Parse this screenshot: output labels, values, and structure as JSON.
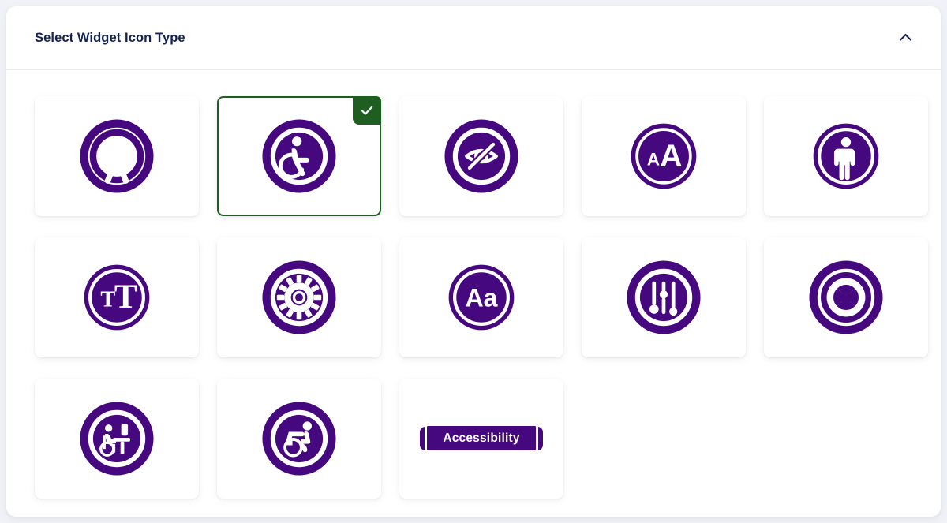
{
  "page": {
    "background_color": "#f1f2f7",
    "panel_background": "#ffffff"
  },
  "header": {
    "title": "Select Widget Icon Type",
    "title_color": "#152252",
    "collapse_icon": "chevron-up-icon",
    "collapsed": false
  },
  "theme": {
    "icon_color": "#46087f",
    "selected_border_color": "#1e5e20",
    "check_badge_color": "#1e5e20",
    "check_mark_color": "#ffffff"
  },
  "grid": {
    "columns": 5,
    "selected_index": 1,
    "items": [
      {
        "index": 0,
        "icon": "accessibility-person-icon",
        "label": "Accessibility Person",
        "selected": false
      },
      {
        "index": 1,
        "icon": "wheelchair-icon",
        "label": "Wheelchair",
        "selected": true
      },
      {
        "index": 2,
        "icon": "eye-slash-icon",
        "label": "Eye Slash",
        "selected": false
      },
      {
        "index": 3,
        "icon": "text-size-aa-icon",
        "label": "Text Size aA",
        "selected": false
      },
      {
        "index": 4,
        "icon": "standing-person-icon",
        "label": "Standing Person",
        "selected": false
      },
      {
        "index": 5,
        "icon": "text-size-tt-icon",
        "label": "Text Size tT",
        "selected": false
      },
      {
        "index": 6,
        "icon": "gear-icon",
        "label": "Gear",
        "selected": false
      },
      {
        "index": 7,
        "icon": "typography-aa-icon",
        "label": "Typography Aa",
        "selected": false
      },
      {
        "index": 8,
        "icon": "sliders-icon",
        "label": "Sliders",
        "selected": false
      },
      {
        "index": 9,
        "icon": "life-ring-icon",
        "label": "Life Ring",
        "selected": false
      },
      {
        "index": 10,
        "icon": "wheelchair-desk-icon",
        "label": "Wheelchair At Desk",
        "selected": false
      },
      {
        "index": 11,
        "icon": "active-wheelchair-icon",
        "label": "Active Wheelchair",
        "selected": false
      },
      {
        "index": 12,
        "icon": "accessibility-text-badge",
        "label": "Accessibility",
        "selected": false
      }
    ]
  },
  "text_badge": {
    "label": "Accessibility"
  }
}
